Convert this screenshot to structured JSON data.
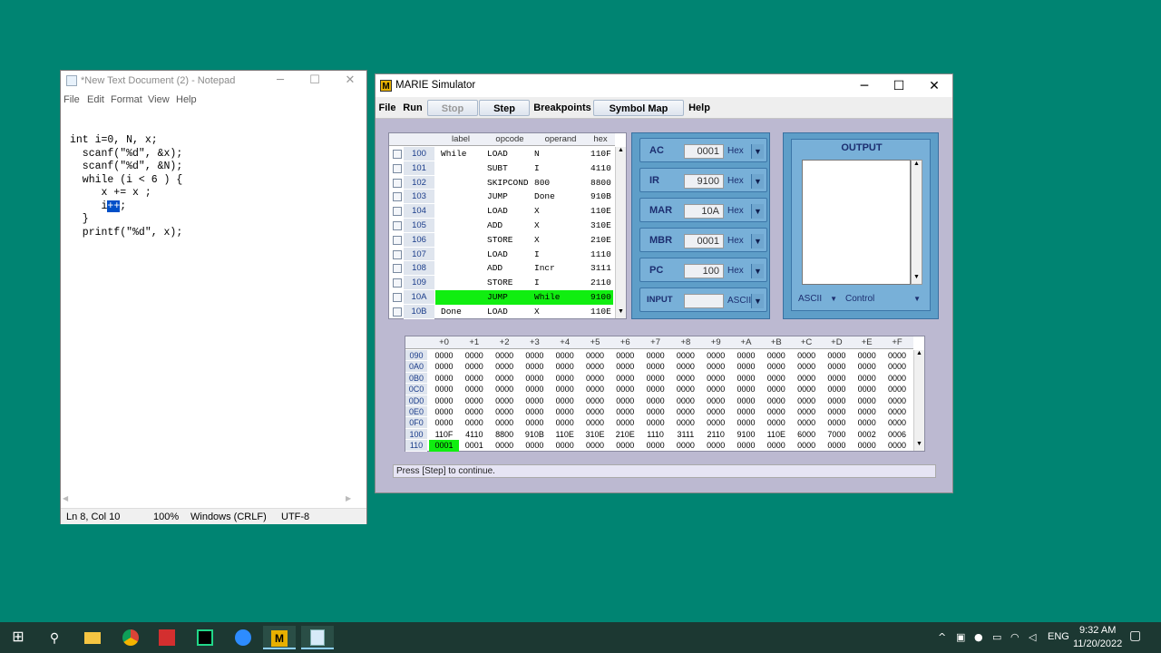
{
  "notepad": {
    "title": "*New Text Document (2) - Notepad",
    "menu": [
      "File",
      "Edit",
      "Format",
      "View",
      "Help"
    ],
    "lines": [
      "int i=0, N, x;",
      "  scanf(\"%d\", &x);",
      "  scanf(\"%d\", &N);",
      "  while (i < 6 ) {",
      "     x += x ;",
      "     i",
      "  }",
      "  printf(\"%d\", x);"
    ],
    "line6_selected": "++",
    "line6_after": ";",
    "status": {
      "position": "Ln 8, Col 10",
      "zoom": "100%",
      "eol": "Windows (CRLF)",
      "encoding": "UTF-8"
    }
  },
  "marie": {
    "title": "MARIE Simulator",
    "logo": "M",
    "menu": {
      "file": "File",
      "run": "Run",
      "stop": "Stop",
      "step": "Step",
      "breakpoints": "Breakpoints",
      "symbol_map": "Symbol Map",
      "help": "Help"
    },
    "program": {
      "headers": [
        "label",
        "opcode",
        "operand",
        "hex"
      ],
      "rows": [
        {
          "addr": "100",
          "label": "While",
          "opcode": "LOAD",
          "operand": "N",
          "hex": "110F"
        },
        {
          "addr": "101",
          "label": "",
          "opcode": "SUBT",
          "operand": "I",
          "hex": "4110"
        },
        {
          "addr": "102",
          "label": "",
          "opcode": "SKIPCOND",
          "operand": "800",
          "hex": "8800"
        },
        {
          "addr": "103",
          "label": "",
          "opcode": "JUMP",
          "operand": "Done",
          "hex": "910B"
        },
        {
          "addr": "104",
          "label": "",
          "opcode": "LOAD",
          "operand": "X",
          "hex": "110E"
        },
        {
          "addr": "105",
          "label": "",
          "opcode": "ADD",
          "operand": "X",
          "hex": "310E"
        },
        {
          "addr": "106",
          "label": "",
          "opcode": "STORE",
          "operand": "X",
          "hex": "210E"
        },
        {
          "addr": "107",
          "label": "",
          "opcode": "LOAD",
          "operand": "I",
          "hex": "1110"
        },
        {
          "addr": "108",
          "label": "",
          "opcode": "ADD",
          "operand": "Incr",
          "hex": "3111"
        },
        {
          "addr": "109",
          "label": "",
          "opcode": "STORE",
          "operand": "I",
          "hex": "2110"
        },
        {
          "addr": "10A",
          "label": "",
          "opcode": "JUMP",
          "operand": "While",
          "hex": "9100",
          "highlight": true
        },
        {
          "addr": "10B",
          "label": "Done",
          "opcode": "LOAD",
          "operand": "X",
          "hex": "110E"
        }
      ]
    },
    "registers": [
      {
        "name": "AC",
        "value": "0001",
        "format": "Hex"
      },
      {
        "name": "IR",
        "value": "9100",
        "format": "Hex"
      },
      {
        "name": "MAR",
        "value": "10A",
        "format": "Hex"
      },
      {
        "name": "MBR",
        "value": "0001",
        "format": "Hex"
      },
      {
        "name": "PC",
        "value": "100",
        "format": "Hex"
      },
      {
        "name": "INPUT",
        "value": "",
        "format": "ASCII"
      }
    ],
    "output": {
      "title": "OUTPUT",
      "format": "ASCII",
      "mode": "Control"
    },
    "memory": {
      "headers": [
        "+0",
        "+1",
        "+2",
        "+3",
        "+4",
        "+5",
        "+6",
        "+7",
        "+8",
        "+9",
        "+A",
        "+B",
        "+C",
        "+D",
        "+E",
        "+F"
      ],
      "rows": [
        {
          "addr": "090",
          "cells": [
            "0000",
            "0000",
            "0000",
            "0000",
            "0000",
            "0000",
            "0000",
            "0000",
            "0000",
            "0000",
            "0000",
            "0000",
            "0000",
            "0000",
            "0000",
            "0000"
          ]
        },
        {
          "addr": "0A0",
          "cells": [
            "0000",
            "0000",
            "0000",
            "0000",
            "0000",
            "0000",
            "0000",
            "0000",
            "0000",
            "0000",
            "0000",
            "0000",
            "0000",
            "0000",
            "0000",
            "0000"
          ]
        },
        {
          "addr": "0B0",
          "cells": [
            "0000",
            "0000",
            "0000",
            "0000",
            "0000",
            "0000",
            "0000",
            "0000",
            "0000",
            "0000",
            "0000",
            "0000",
            "0000",
            "0000",
            "0000",
            "0000"
          ]
        },
        {
          "addr": "0C0",
          "cells": [
            "0000",
            "0000",
            "0000",
            "0000",
            "0000",
            "0000",
            "0000",
            "0000",
            "0000",
            "0000",
            "0000",
            "0000",
            "0000",
            "0000",
            "0000",
            "0000"
          ]
        },
        {
          "addr": "0D0",
          "cells": [
            "0000",
            "0000",
            "0000",
            "0000",
            "0000",
            "0000",
            "0000",
            "0000",
            "0000",
            "0000",
            "0000",
            "0000",
            "0000",
            "0000",
            "0000",
            "0000"
          ]
        },
        {
          "addr": "0E0",
          "cells": [
            "0000",
            "0000",
            "0000",
            "0000",
            "0000",
            "0000",
            "0000",
            "0000",
            "0000",
            "0000",
            "0000",
            "0000",
            "0000",
            "0000",
            "0000",
            "0000"
          ]
        },
        {
          "addr": "0F0",
          "cells": [
            "0000",
            "0000",
            "0000",
            "0000",
            "0000",
            "0000",
            "0000",
            "0000",
            "0000",
            "0000",
            "0000",
            "0000",
            "0000",
            "0000",
            "0000",
            "0000"
          ]
        },
        {
          "addr": "100",
          "cells": [
            "110F",
            "4110",
            "8800",
            "910B",
            "110E",
            "310E",
            "210E",
            "1110",
            "3111",
            "2110",
            "9100",
            "110E",
            "6000",
            "7000",
            "0002",
            "0006"
          ]
        },
        {
          "addr": "110",
          "cells": [
            "0001",
            "0001",
            "0000",
            "0000",
            "0000",
            "0000",
            "0000",
            "0000",
            "0000",
            "0000",
            "0000",
            "0000",
            "0000",
            "0000",
            "0000",
            "0000"
          ],
          "highlight_index": 0
        }
      ]
    },
    "status": "Press [Step] to continue."
  },
  "taskbar": {
    "tray_lang": "ENG",
    "time": "9:32 AM",
    "date": "11/20/2022",
    "apps": [
      "windows-start",
      "search",
      "file-explorer",
      "chrome",
      "acrobat",
      "pycharm",
      "zoom",
      "marie",
      "notepad"
    ]
  },
  "colors": {
    "desktop": "#008472",
    "highlight": "#10ee10",
    "panel": "#5e9ec8"
  }
}
